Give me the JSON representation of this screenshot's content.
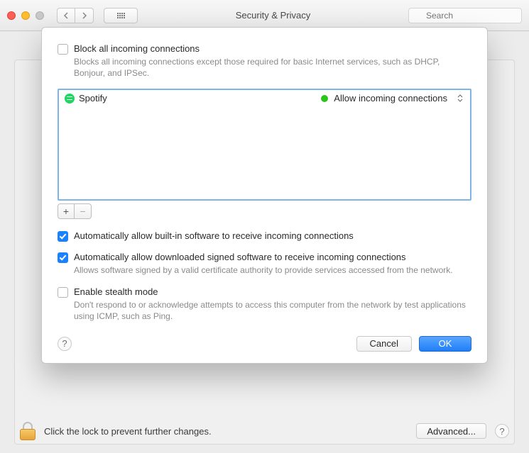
{
  "titlebar": {
    "title": "Security & Privacy",
    "search_placeholder": "Search"
  },
  "sheet": {
    "block_all": {
      "label": "Block all incoming connections",
      "desc": "Blocks all incoming connections except those required for basic Internet services, such as DHCP, Bonjour, and IPSec.",
      "checked": false
    },
    "apps": [
      {
        "name": "Spotify",
        "icon": "spotify",
        "status_label": "Allow incoming connections",
        "status_color": "#2bc41e"
      }
    ],
    "auto_builtin": {
      "label": "Automatically allow built-in software to receive incoming connections",
      "checked": true
    },
    "auto_signed": {
      "label": "Automatically allow downloaded signed software to receive incoming connections",
      "desc": "Allows software signed by a valid certificate authority to provide services accessed from the network.",
      "checked": true
    },
    "stealth": {
      "label": "Enable stealth mode",
      "desc": "Don't respond to or acknowledge attempts to access this computer from the network by test applications using ICMP, such as Ping.",
      "checked": false
    },
    "buttons": {
      "cancel": "Cancel",
      "ok": "OK"
    }
  },
  "footer": {
    "lock_text": "Click the lock to prevent further changes.",
    "advanced": "Advanced..."
  }
}
